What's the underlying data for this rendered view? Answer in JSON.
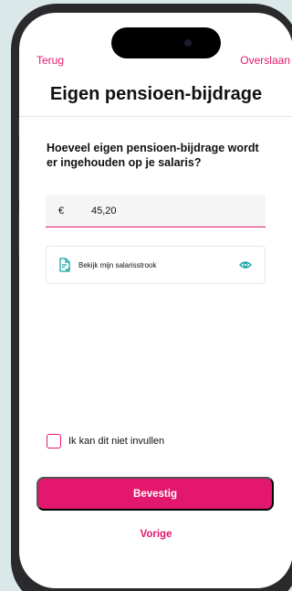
{
  "nav": {
    "back_label": "Terug",
    "skip_label": "Overslaan"
  },
  "page": {
    "title": "Eigen pensioen-bijdrage"
  },
  "question": {
    "text": "Hoeveel eigen pensioen-bijdrage wordt er ingehouden op je salaris?"
  },
  "amount": {
    "currency": "€",
    "value": "45,20"
  },
  "payslip": {
    "label": "Bekijk mijn salarisstrook",
    "icon": "document-check-icon",
    "action_icon": "eye-icon"
  },
  "checkbox": {
    "label": "Ik kan dit niet invullen",
    "checked": false
  },
  "buttons": {
    "confirm_label": "Bevestig",
    "previous_label": "Vorige"
  },
  "colors": {
    "accent": "#e3176d",
    "icon_teal": "#16a3a3",
    "background": "#dbe8ea"
  }
}
